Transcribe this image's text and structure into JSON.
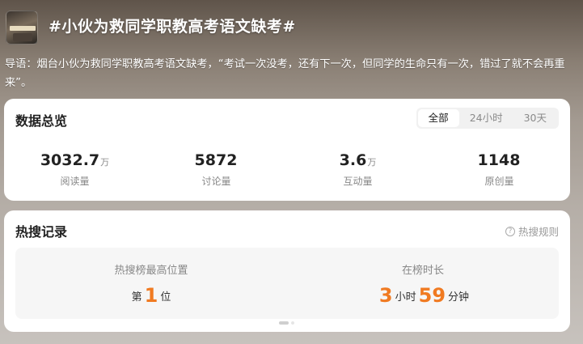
{
  "topic": {
    "title": "#小伙为救同学职教高考语文缺考#",
    "intro": "导语：烟台小伙为救同学职教高考语文缺考，“考试一次没考，还有下一次，但同学的生命只有一次，错过了就不会再重来”。"
  },
  "overview": {
    "title": "数据总览",
    "tabs": [
      {
        "label": "全部",
        "active": true
      },
      {
        "label": "24小时",
        "active": false
      },
      {
        "label": "30天",
        "active": false
      }
    ],
    "stats": [
      {
        "value": "3032.7",
        "unit": "万",
        "label": "阅读量"
      },
      {
        "value": "5872",
        "unit": "",
        "label": "讨论量"
      },
      {
        "value": "3.6",
        "unit": "万",
        "label": "互动量"
      },
      {
        "value": "1148",
        "unit": "",
        "label": "原创量"
      }
    ]
  },
  "hot": {
    "title": "热搜记录",
    "rules_label": "热搜规则",
    "help_icon": "question-circle-icon",
    "peak": {
      "label": "热搜榜最高位置",
      "prefix": "第",
      "rank": "1",
      "suffix": "位"
    },
    "duration": {
      "label": "在榜时长",
      "hours": "3",
      "hours_unit": "小时",
      "minutes": "59",
      "minutes_unit": "分钟"
    }
  },
  "colors": {
    "accent": "#f07a21",
    "card_bg": "#ffffff",
    "muted_text": "#888888"
  }
}
